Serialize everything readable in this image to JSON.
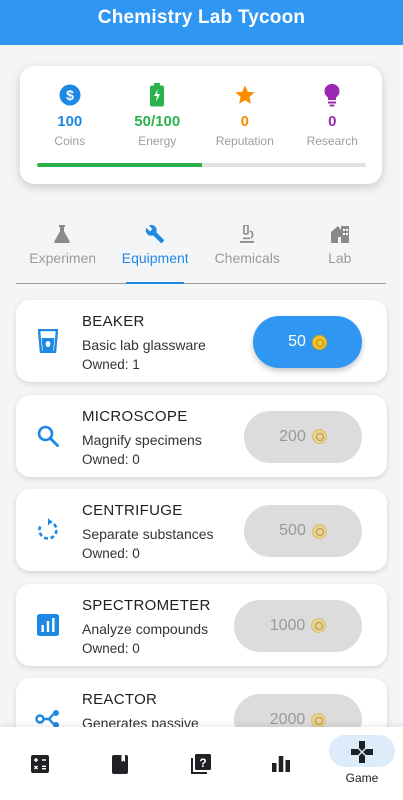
{
  "app": {
    "title": "Chemistry Lab Tycoon"
  },
  "stats": [
    {
      "key": "coins",
      "icon": "dollar-icon",
      "value": "100",
      "label": "Coins",
      "color": "#1e88e5"
    },
    {
      "key": "energy",
      "icon": "battery-icon",
      "value": "50/100",
      "label": "Energy",
      "color": "#2bb24c"
    },
    {
      "key": "reputation",
      "icon": "star-icon",
      "value": "0",
      "label": "Reputation",
      "color": "#fb8c00"
    },
    {
      "key": "research",
      "icon": "lightbulb-icon",
      "value": "0",
      "label": "Research",
      "color": "#9c27b0"
    }
  ],
  "energy_progress": 0.5,
  "tabs": [
    {
      "label": "Experiments",
      "icon": "flask-icon",
      "active": false
    },
    {
      "label": "Equipment",
      "icon": "wrench-icon",
      "active": true
    },
    {
      "label": "Chemicals",
      "icon": "microscope-icon",
      "active": false
    },
    {
      "label": "Lab",
      "icon": "house-icon",
      "active": false
    }
  ],
  "equipment": [
    {
      "name": "BEAKER",
      "description": "Basic lab glassware",
      "owned": "Owned: 1",
      "price": "50",
      "affordable": true,
      "icon": "beaker-icon"
    },
    {
      "name": "MICROSCOPE",
      "description": "Magnify specimens",
      "owned": "Owned: 0",
      "price": "200",
      "affordable": false,
      "icon": "magnifier-icon"
    },
    {
      "name": "CENTRIFUGE",
      "description": "Separate substances",
      "owned": "Owned: 0",
      "price": "500",
      "affordable": false,
      "icon": "rotate-icon"
    },
    {
      "name": "SPECTROMETER",
      "description": "Analyze compounds",
      "owned": "Owned: 0",
      "price": "1000",
      "affordable": false,
      "icon": "chart-icon"
    },
    {
      "name": "REACTOR",
      "description": "Generates passive",
      "owned": "",
      "price": "2000",
      "affordable": false,
      "icon": "share-icon"
    }
  ],
  "bottom_nav": [
    {
      "icon": "calculator-icon",
      "label": "",
      "active": false
    },
    {
      "icon": "book-icon",
      "label": "",
      "active": false
    },
    {
      "icon": "quiz-icon",
      "label": "",
      "active": false
    },
    {
      "icon": "leaderboard-icon",
      "label": "",
      "active": false
    },
    {
      "icon": "gamepad-icon",
      "label": "Game",
      "active": true
    }
  ],
  "colors": {
    "primary": "#2f96f3",
    "accent_blue": "#1e88e5",
    "progress_green": "#2bb24c"
  }
}
